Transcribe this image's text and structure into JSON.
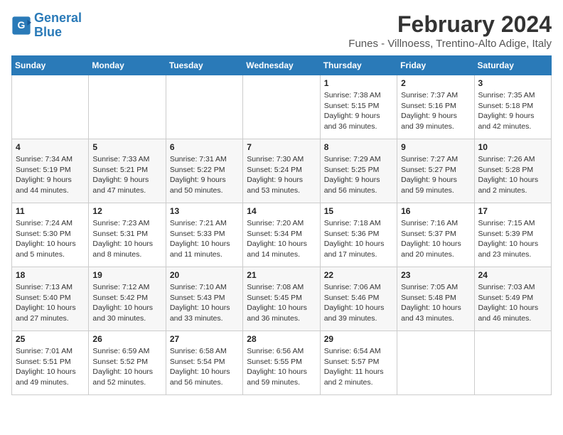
{
  "logo": {
    "line1": "General",
    "line2": "Blue"
  },
  "title": "February 2024",
  "subtitle": "Funes - Villnoess, Trentino-Alto Adige, Italy",
  "headers": [
    "Sunday",
    "Monday",
    "Tuesday",
    "Wednesday",
    "Thursday",
    "Friday",
    "Saturday"
  ],
  "weeks": [
    [
      {
        "day": "",
        "detail": ""
      },
      {
        "day": "",
        "detail": ""
      },
      {
        "day": "",
        "detail": ""
      },
      {
        "day": "",
        "detail": ""
      },
      {
        "day": "1",
        "detail": "Sunrise: 7:38 AM\nSunset: 5:15 PM\nDaylight: 9 hours and 36 minutes."
      },
      {
        "day": "2",
        "detail": "Sunrise: 7:37 AM\nSunset: 5:16 PM\nDaylight: 9 hours and 39 minutes."
      },
      {
        "day": "3",
        "detail": "Sunrise: 7:35 AM\nSunset: 5:18 PM\nDaylight: 9 hours and 42 minutes."
      }
    ],
    [
      {
        "day": "4",
        "detail": "Sunrise: 7:34 AM\nSunset: 5:19 PM\nDaylight: 9 hours and 44 minutes."
      },
      {
        "day": "5",
        "detail": "Sunrise: 7:33 AM\nSunset: 5:21 PM\nDaylight: 9 hours and 47 minutes."
      },
      {
        "day": "6",
        "detail": "Sunrise: 7:31 AM\nSunset: 5:22 PM\nDaylight: 9 hours and 50 minutes."
      },
      {
        "day": "7",
        "detail": "Sunrise: 7:30 AM\nSunset: 5:24 PM\nDaylight: 9 hours and 53 minutes."
      },
      {
        "day": "8",
        "detail": "Sunrise: 7:29 AM\nSunset: 5:25 PM\nDaylight: 9 hours and 56 minutes."
      },
      {
        "day": "9",
        "detail": "Sunrise: 7:27 AM\nSunset: 5:27 PM\nDaylight: 9 hours and 59 minutes."
      },
      {
        "day": "10",
        "detail": "Sunrise: 7:26 AM\nSunset: 5:28 PM\nDaylight: 10 hours and 2 minutes."
      }
    ],
    [
      {
        "day": "11",
        "detail": "Sunrise: 7:24 AM\nSunset: 5:30 PM\nDaylight: 10 hours and 5 minutes."
      },
      {
        "day": "12",
        "detail": "Sunrise: 7:23 AM\nSunset: 5:31 PM\nDaylight: 10 hours and 8 minutes."
      },
      {
        "day": "13",
        "detail": "Sunrise: 7:21 AM\nSunset: 5:33 PM\nDaylight: 10 hours and 11 minutes."
      },
      {
        "day": "14",
        "detail": "Sunrise: 7:20 AM\nSunset: 5:34 PM\nDaylight: 10 hours and 14 minutes."
      },
      {
        "day": "15",
        "detail": "Sunrise: 7:18 AM\nSunset: 5:36 PM\nDaylight: 10 hours and 17 minutes."
      },
      {
        "day": "16",
        "detail": "Sunrise: 7:16 AM\nSunset: 5:37 PM\nDaylight: 10 hours and 20 minutes."
      },
      {
        "day": "17",
        "detail": "Sunrise: 7:15 AM\nSunset: 5:39 PM\nDaylight: 10 hours and 23 minutes."
      }
    ],
    [
      {
        "day": "18",
        "detail": "Sunrise: 7:13 AM\nSunset: 5:40 PM\nDaylight: 10 hours and 27 minutes."
      },
      {
        "day": "19",
        "detail": "Sunrise: 7:12 AM\nSunset: 5:42 PM\nDaylight: 10 hours and 30 minutes."
      },
      {
        "day": "20",
        "detail": "Sunrise: 7:10 AM\nSunset: 5:43 PM\nDaylight: 10 hours and 33 minutes."
      },
      {
        "day": "21",
        "detail": "Sunrise: 7:08 AM\nSunset: 5:45 PM\nDaylight: 10 hours and 36 minutes."
      },
      {
        "day": "22",
        "detail": "Sunrise: 7:06 AM\nSunset: 5:46 PM\nDaylight: 10 hours and 39 minutes."
      },
      {
        "day": "23",
        "detail": "Sunrise: 7:05 AM\nSunset: 5:48 PM\nDaylight: 10 hours and 43 minutes."
      },
      {
        "day": "24",
        "detail": "Sunrise: 7:03 AM\nSunset: 5:49 PM\nDaylight: 10 hours and 46 minutes."
      }
    ],
    [
      {
        "day": "25",
        "detail": "Sunrise: 7:01 AM\nSunset: 5:51 PM\nDaylight: 10 hours and 49 minutes."
      },
      {
        "day": "26",
        "detail": "Sunrise: 6:59 AM\nSunset: 5:52 PM\nDaylight: 10 hours and 52 minutes."
      },
      {
        "day": "27",
        "detail": "Sunrise: 6:58 AM\nSunset: 5:54 PM\nDaylight: 10 hours and 56 minutes."
      },
      {
        "day": "28",
        "detail": "Sunrise: 6:56 AM\nSunset: 5:55 PM\nDaylight: 10 hours and 59 minutes."
      },
      {
        "day": "29",
        "detail": "Sunrise: 6:54 AM\nSunset: 5:57 PM\nDaylight: 11 hours and 2 minutes."
      },
      {
        "day": "",
        "detail": ""
      },
      {
        "day": "",
        "detail": ""
      }
    ]
  ]
}
